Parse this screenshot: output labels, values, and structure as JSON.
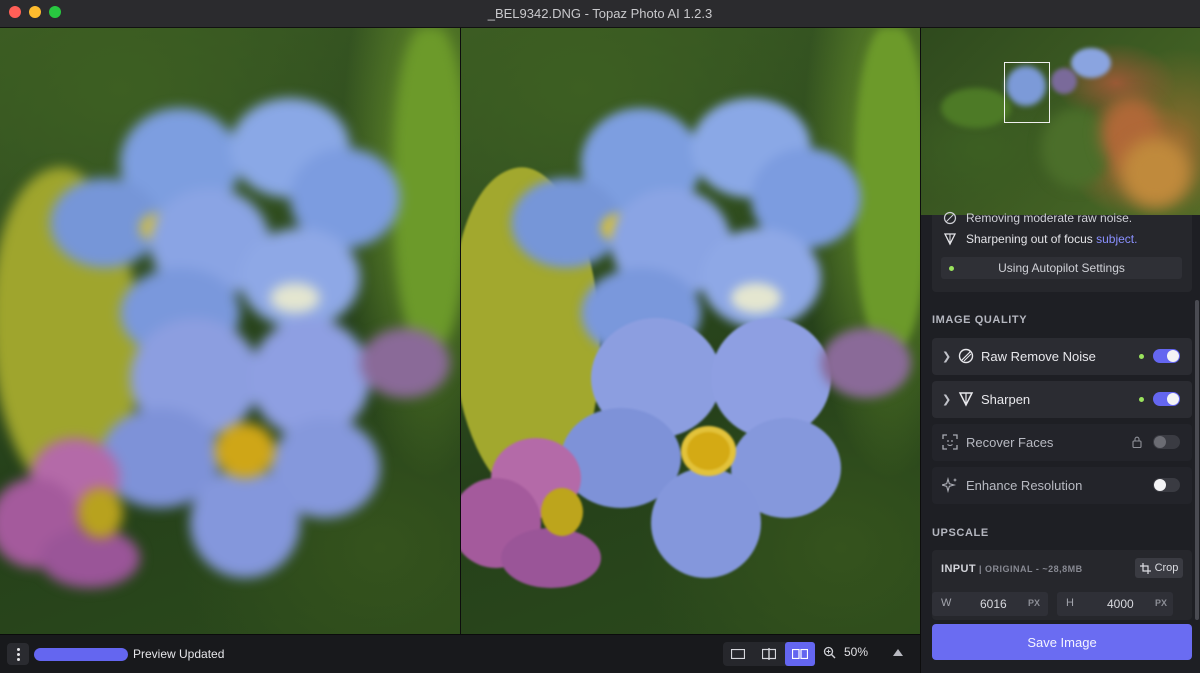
{
  "window": {
    "title": "_BEL9342.DNG - Topaz Photo AI 1.2.3"
  },
  "status": {
    "preview_label": "Preview Updated",
    "progress": 1.0
  },
  "view": {
    "modes": [
      "single-view",
      "split-view",
      "side-by-side-view"
    ],
    "active_mode": "side-by-side-view",
    "zoom": "50%"
  },
  "autopilot": {
    "lines": [
      {
        "text": "Removing moderate raw noise."
      },
      {
        "text": "Sharpening out of focus ",
        "highlight": "subject."
      }
    ],
    "button_label": "Using Autopilot Settings"
  },
  "image_quality": {
    "heading": "IMAGE QUALITY",
    "tools": [
      {
        "label": "Raw Remove Noise",
        "enabled": true,
        "status_dot": true,
        "expandable": true,
        "icon": "noise-icon"
      },
      {
        "label": "Sharpen",
        "enabled": true,
        "status_dot": true,
        "expandable": true,
        "icon": "sharpen-icon"
      },
      {
        "label": "Recover Faces",
        "enabled": false,
        "locked": true,
        "expandable": false,
        "icon": "face-icon"
      },
      {
        "label": "Enhance Resolution",
        "enabled": false,
        "expandable": false,
        "icon": "sparkle-icon"
      }
    ]
  },
  "upscale": {
    "heading": "UPSCALE",
    "input_label": "INPUT",
    "input_sub": "| ORIGINAL - ~28,8MB",
    "crop_label": "Crop",
    "width": {
      "key": "W",
      "value": "6016",
      "unit": "PX"
    },
    "height": {
      "key": "H",
      "value": "4000",
      "unit": "PX"
    }
  },
  "actions": {
    "save_label": "Save Image"
  },
  "colors": {
    "accent": "#6466f0",
    "status_green": "#9ae35d",
    "link": "#8a90ff"
  }
}
